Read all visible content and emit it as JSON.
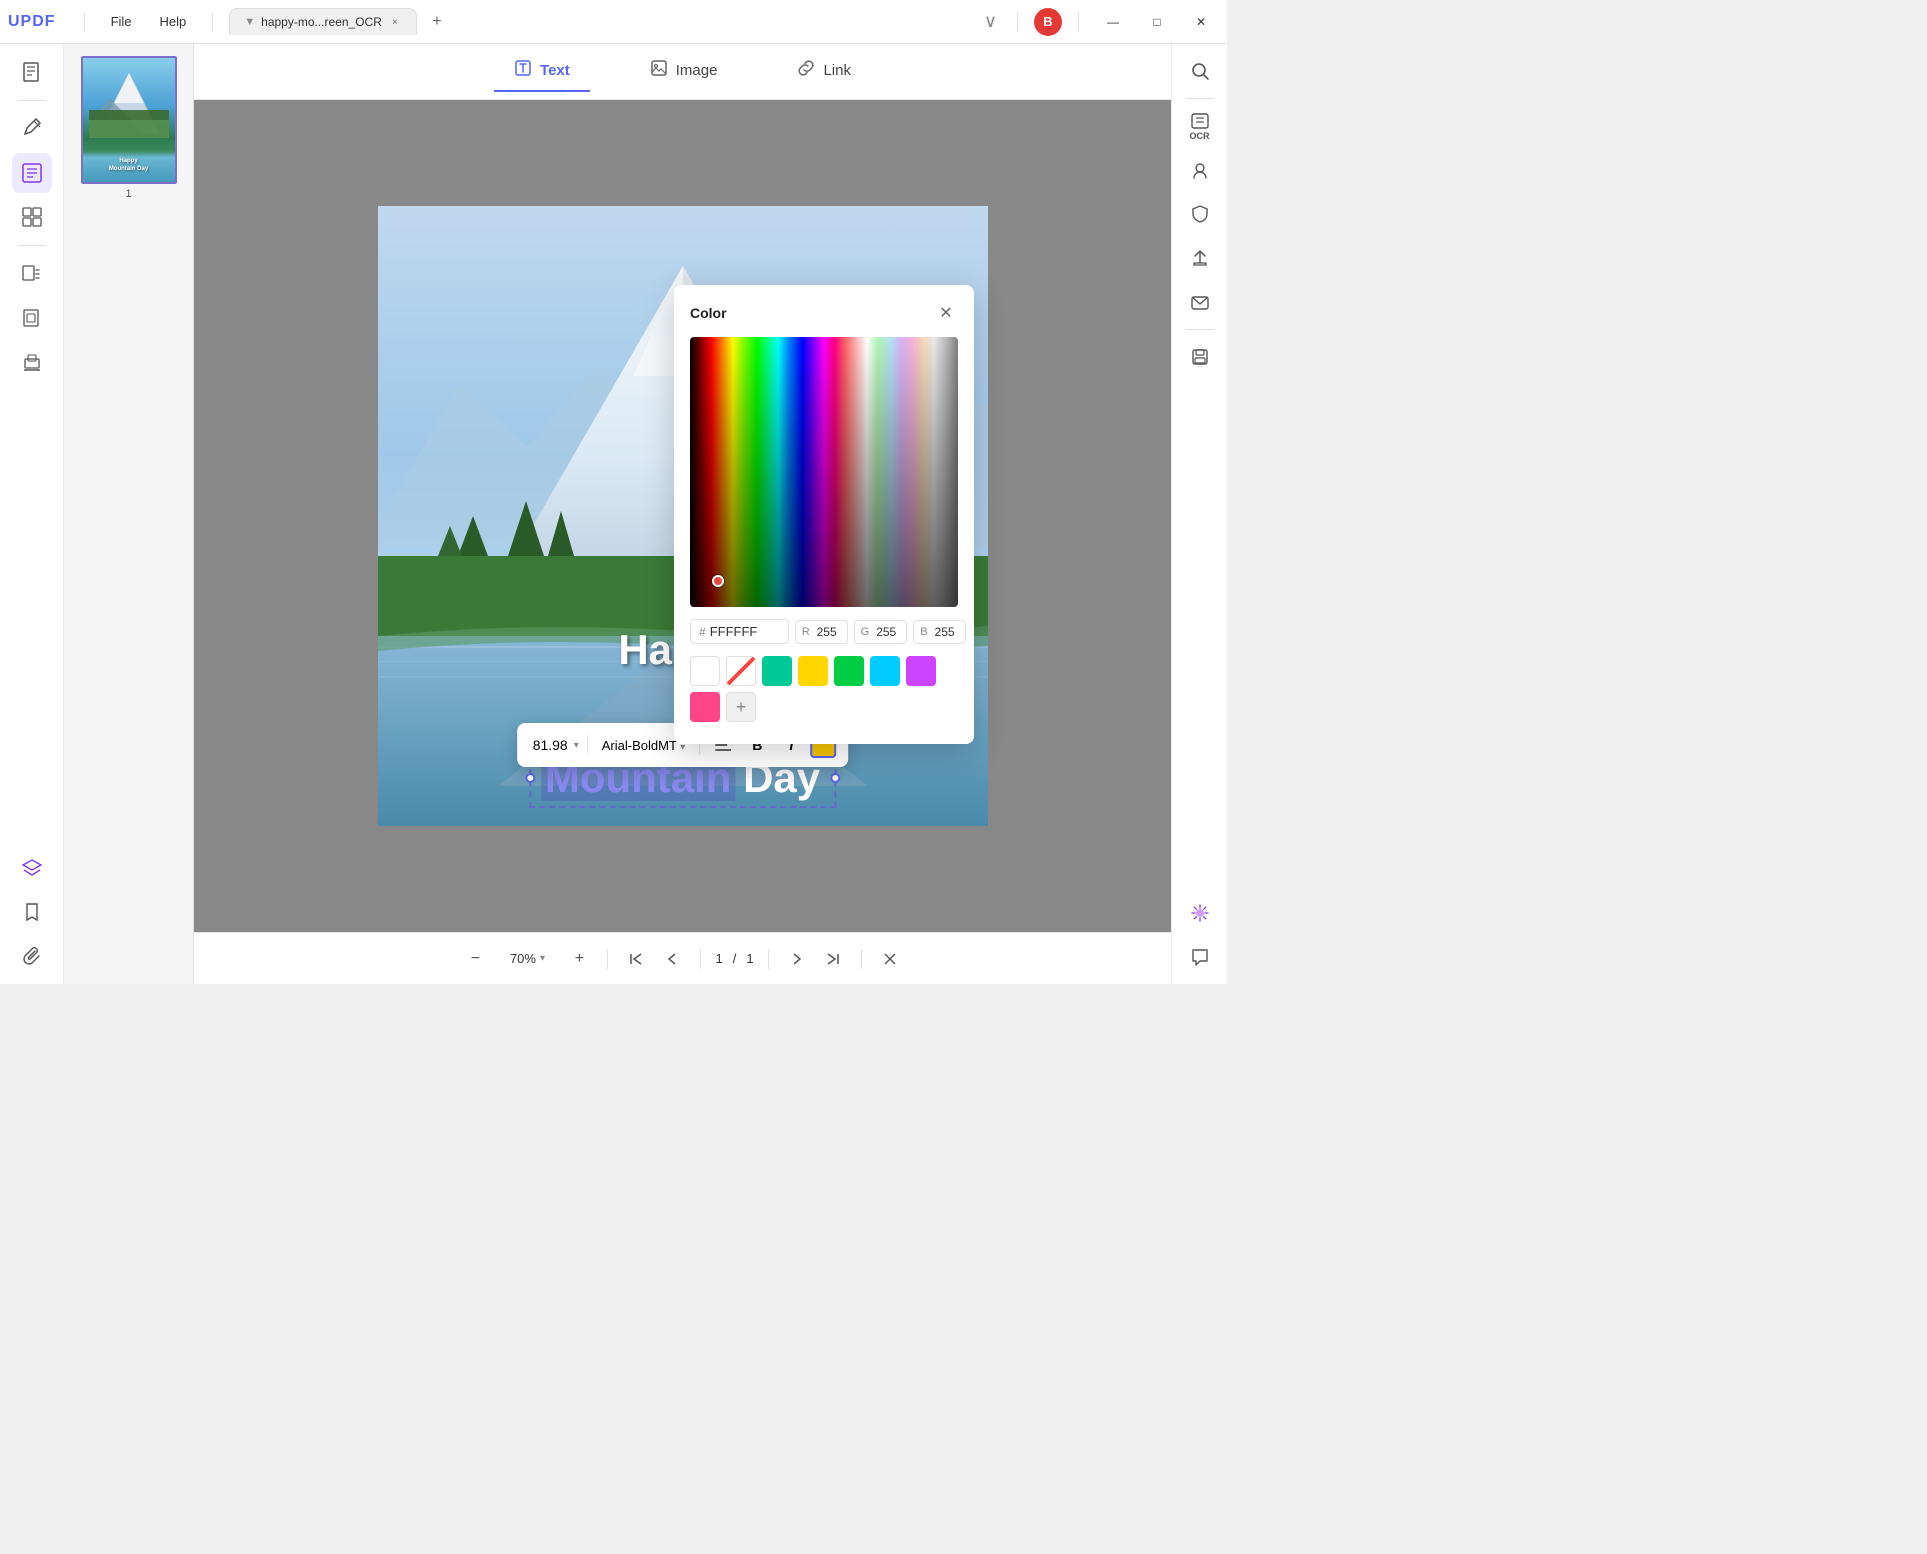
{
  "app": {
    "name": "UPDF",
    "logo": "UPDF"
  },
  "titlebar": {
    "menu_file": "File",
    "menu_help": "Help",
    "tab_name": "happy-mo...reen_OCR",
    "tab_close": "×",
    "tab_add": "+",
    "dropdown_arrow": "∨",
    "avatar_letter": "B",
    "win_minimize": "—",
    "win_maximize": "□",
    "win_close": "✕"
  },
  "sidebar": {
    "icons": [
      {
        "name": "read-icon",
        "symbol": "📄",
        "active": false
      },
      {
        "name": "edit-icon",
        "symbol": "✏️",
        "active": false
      },
      {
        "name": "annotate-icon",
        "symbol": "📝",
        "active": true
      },
      {
        "name": "organize-icon",
        "symbol": "⊞",
        "active": false
      },
      {
        "name": "convert-icon",
        "symbol": "⟳",
        "active": false
      },
      {
        "name": "extract-icon",
        "symbol": "⊡",
        "active": false
      },
      {
        "name": "stamp-icon",
        "symbol": "⊕",
        "active": false
      }
    ],
    "bottom_icons": [
      {
        "name": "layers-icon",
        "symbol": "◈"
      },
      {
        "name": "bookmark-icon",
        "symbol": "🔖"
      },
      {
        "name": "attach-icon",
        "symbol": "📎"
      }
    ]
  },
  "toolbar": {
    "tabs": [
      {
        "id": "text",
        "label": "Text",
        "active": true
      },
      {
        "id": "image",
        "label": "Image",
        "active": false
      },
      {
        "id": "link",
        "label": "Link",
        "active": false
      }
    ]
  },
  "format_bar": {
    "font_size": "81.98",
    "dropdown_arrow": "▾",
    "font_name": "Arial-BoldMT",
    "align_icon": "≡",
    "bold_label": "B",
    "italic_label": "I"
  },
  "color_picker": {
    "title": "Color",
    "close": "✕",
    "hex_label": "#",
    "hex_value": "FFFFFF",
    "r_label": "R",
    "r_value": "255",
    "g_label": "G",
    "g_value": "255",
    "b_label": "B",
    "b_value": "255",
    "swatches": [
      "white",
      "diag",
      "teal",
      "yellow",
      "green",
      "cyan",
      "purple",
      "pink",
      "add"
    ]
  },
  "page": {
    "text_line1": "Happy",
    "text_line2_mountain": "Mountain",
    "text_line2_day": " Day",
    "number": "1"
  },
  "bottom_toolbar": {
    "zoom_out": "−",
    "zoom_level": "70%",
    "zoom_dropdown": "▾",
    "zoom_in": "+",
    "nav_top": "⇈",
    "nav_up": "↑",
    "page_current": "1",
    "page_sep": "/",
    "page_total": "1",
    "nav_down": "↓",
    "nav_bottom": "⇊",
    "close": "✕"
  },
  "right_sidebar": {
    "icons": [
      {
        "name": "search-icon",
        "symbol": "🔍"
      },
      {
        "name": "ocr-icon",
        "label": "OCR"
      },
      {
        "name": "recognize-icon",
        "symbol": "👁"
      },
      {
        "name": "protect-icon",
        "symbol": "🔒"
      },
      {
        "name": "share-icon",
        "symbol": "⬆"
      },
      {
        "name": "email-icon",
        "symbol": "✉"
      },
      {
        "name": "save-icon",
        "symbol": "💾"
      }
    ],
    "bottom_icons": [
      {
        "name": "ai-icon",
        "symbol": "✦"
      },
      {
        "name": "comment-icon",
        "symbol": "💬"
      }
    ]
  }
}
